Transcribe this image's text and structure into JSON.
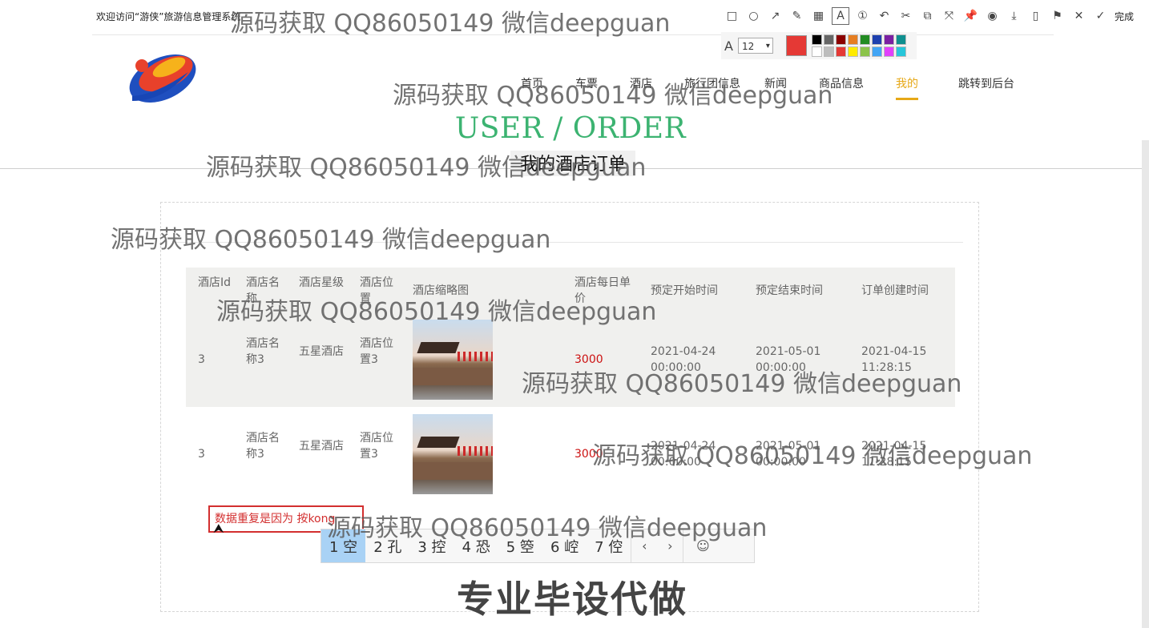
{
  "welcome_text": "欢迎访问“游侠”旅游信息管理系统",
  "nav": {
    "items": [
      "首页",
      "车票",
      "酒店",
      "旅行团信息",
      "新闻",
      "商品信息",
      "我的",
      "跳转到后台"
    ],
    "active_index": 6
  },
  "header": {
    "title": "USER / ORDER",
    "subtitle": "我的酒店订单"
  },
  "table": {
    "columns": [
      "酒店Id",
      "酒店名称",
      "酒店星级",
      "酒店位置",
      "酒店缩略图",
      "酒店每日单价",
      "预定开始时间",
      "预定结束时间",
      "订单创建时间"
    ],
    "rows": [
      {
        "id": "3",
        "name": "酒店名称3",
        "star": "五星酒店",
        "location": "酒店位置3",
        "price": "3000",
        "start": "2021-04-24 00:00:00",
        "end": "2021-05-01 00:00:00",
        "created": "2021-04-15 11:28:15"
      },
      {
        "id": "3",
        "name": "酒店名称3",
        "star": "五星酒店",
        "location": "酒店位置3",
        "price": "3000",
        "start": "2021-04-24 00:00:00",
        "end": "2021-05-01 00:00:00",
        "created": "2021-04-15 11:28:15"
      }
    ]
  },
  "annotation": {
    "text": "数据重复是因为 按kong"
  },
  "ime": {
    "candidates": [
      "1 空",
      "2 孔",
      "3 控",
      "4 恐",
      "5 箜",
      "6 崆",
      "7 倥"
    ],
    "selected_index": 0,
    "prev": "‹",
    "next": "›",
    "emoji": "☺"
  },
  "toolbar": {
    "icons": [
      "rectangle-icon",
      "ellipse-icon",
      "arrow-icon",
      "pen-icon",
      "mosaic-icon",
      "text-icon",
      "number-icon",
      "undo-icon",
      "cut-icon",
      "ocr-icon",
      "translate-icon",
      "pin-icon",
      "record-icon",
      "download-icon",
      "long-screenshot-icon",
      "bookmark-icon",
      "close-icon",
      "done-icon"
    ],
    "done_label": "完成",
    "font_size": "12",
    "current_color": "#e53935",
    "swatches": [
      "#000000",
      "#666666",
      "#8b0000",
      "#e67e22",
      "#228b22",
      "#1e40af",
      "#7b1fa2",
      "#0e8f8f",
      "#ffffff",
      "#bdbdbd",
      "#e53935",
      "#ffeb00",
      "#8bc34a",
      "#42a5f5",
      "#e040fb",
      "#26c6da"
    ]
  },
  "watermarks": [
    "源码获取 QQ86050149 微信deepguan",
    "源码获取 QQ86050149 微信deepguan",
    "源码获取 QQ86050149 微信deepguan",
    "源码获取 QQ86050149 微信deepguan",
    "源码获取 QQ86050149 微信deepguan",
    "源码获取 QQ86050149 微信deepguan",
    "源码获取 QQ86050149 微信deepguan",
    "源码获取 QQ86050149 微信deepguan"
  ],
  "watermark_big": "专业毕设代做",
  "colors": {
    "accent": "#e6a817",
    "title_green": "#3cb371",
    "price_red": "#cc1111"
  }
}
